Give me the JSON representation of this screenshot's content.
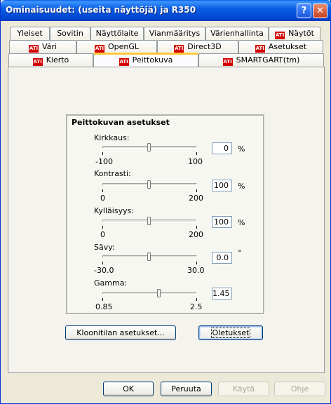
{
  "window": {
    "title": "Ominaisuudet: (useita näyttöjä) ja R350",
    "help_label": "?",
    "close_label": "✕"
  },
  "tabs": {
    "row1": [
      {
        "label": "Yleiset",
        "ati": false
      },
      {
        "label": "Sovitin",
        "ati": false
      },
      {
        "label": "Näyttölaite",
        "ati": false
      },
      {
        "label": "Vianmääritys",
        "ati": false
      },
      {
        "label": "Värienhallinta",
        "ati": false
      },
      {
        "label": "Näytöt",
        "ati": true
      }
    ],
    "row2": [
      {
        "label": "Väri",
        "ati": true
      },
      {
        "label": "OpenGL",
        "ati": true
      },
      {
        "label": "Direct3D",
        "ati": true
      },
      {
        "label": "Asetukset",
        "ati": true
      }
    ],
    "row3": [
      {
        "label": "Kierto",
        "ati": true
      },
      {
        "label": "Peittokuva",
        "ati": true,
        "active": true
      },
      {
        "label": "SMARTGART(tm)",
        "ati": true
      }
    ],
    "ati_logo_text": "ATI"
  },
  "group": {
    "title": "Peittokuvan asetukset",
    "sliders": [
      {
        "label": "Kirkkaus:",
        "min": "-100",
        "max": "100",
        "value": "0",
        "unit": "%",
        "position": 0.5
      },
      {
        "label": "Kontrasti:",
        "min": "0",
        "max": "200",
        "value": "100",
        "unit": "%",
        "position": 0.5
      },
      {
        "label": "Kylläisyys:",
        "min": "0",
        "max": "200",
        "value": "100",
        "unit": "%",
        "position": 0.5
      },
      {
        "label": "Sävy:",
        "min": "-30.0",
        "max": "30.0",
        "value": "0.0",
        "unit": "°",
        "position": 0.5
      },
      {
        "label": "Gamma:",
        "min": "0.85",
        "max": "2.5",
        "value": "1.45",
        "unit": "",
        "position": 0.6
      }
    ]
  },
  "buttons": {
    "clone_settings": "Kloonitilan asetukset...",
    "defaults": "Oletukset",
    "ok": "OK",
    "cancel": "Peruuta",
    "apply": "Käytä",
    "help": "Ohje"
  }
}
